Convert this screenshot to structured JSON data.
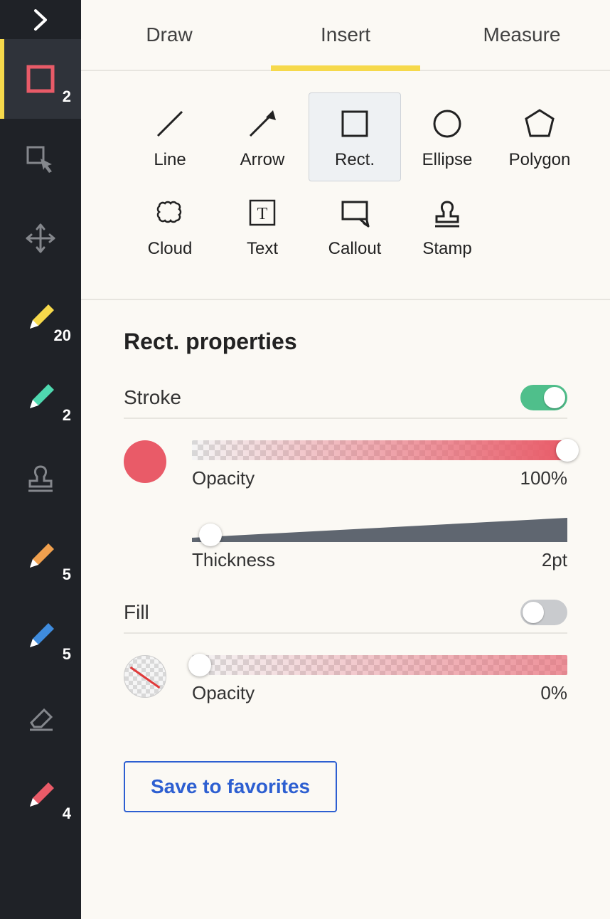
{
  "sidebar": {
    "items": [
      {
        "name": "expand",
        "badge": ""
      },
      {
        "name": "rect-tool",
        "badge": "2",
        "color": "#e95b68"
      },
      {
        "name": "select-tool",
        "badge": ""
      },
      {
        "name": "move-tool",
        "badge": ""
      },
      {
        "name": "pen-yellow",
        "badge": "20",
        "color": "#f6d94b"
      },
      {
        "name": "pen-teal",
        "badge": "2",
        "color": "#4fd9b0"
      },
      {
        "name": "stamp-tool",
        "badge": ""
      },
      {
        "name": "pen-orange",
        "badge": "5",
        "color": "#f0a04e"
      },
      {
        "name": "pen-blue",
        "badge": "5",
        "color": "#3f8cde"
      },
      {
        "name": "eraser-tool",
        "badge": ""
      },
      {
        "name": "pen-red",
        "badge": "4",
        "color": "#e95b68"
      }
    ]
  },
  "tabs": {
    "items": [
      "Draw",
      "Insert",
      "Measure"
    ],
    "activeIndex": 1
  },
  "shapes": {
    "items": [
      "Line",
      "Arrow",
      "Rect.",
      "Ellipse",
      "Polygon",
      "Cloud",
      "Text",
      "Callout",
      "Stamp"
    ],
    "selectedIndex": 2
  },
  "properties": {
    "title": "Rect. properties",
    "stroke": {
      "label": "Stroke",
      "enabled": true,
      "color": "#e95b68",
      "opacityLabel": "Opacity",
      "opacityValue": "100%",
      "opacityPercent": 100,
      "thicknessLabel": "Thickness",
      "thicknessValue": "2pt",
      "thicknessPercent": 5
    },
    "fill": {
      "label": "Fill",
      "enabled": false,
      "opacityLabel": "Opacity",
      "opacityValue": "0%",
      "opacityPercent": 0
    },
    "saveButton": "Save to favorites"
  }
}
